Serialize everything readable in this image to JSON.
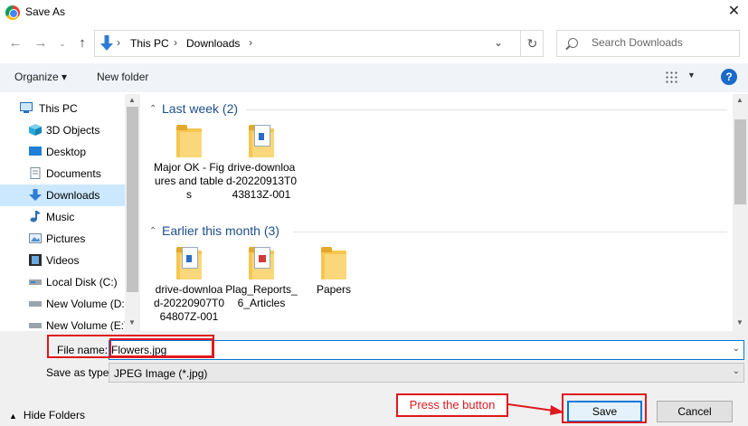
{
  "window": {
    "title": "Save As",
    "close_glyph": "✕",
    "icon": "chrome-icon"
  },
  "address": {
    "crumbs": [
      "This PC",
      "Downloads"
    ],
    "search_placeholder": "Search Downloads"
  },
  "toolbar": {
    "organize_label": "Organize ▾",
    "new_folder_label": "New folder",
    "help_label": "?"
  },
  "nav": {
    "items": [
      {
        "label": "This PC",
        "icon": "computer-icon"
      },
      {
        "label": "3D Objects",
        "icon": "cube-icon"
      },
      {
        "label": "Desktop",
        "icon": "desktop-icon"
      },
      {
        "label": "Documents",
        "icon": "documents-icon"
      },
      {
        "label": "Downloads",
        "icon": "download-arrow-icon",
        "selected": true
      },
      {
        "label": "Music",
        "icon": "music-note-icon"
      },
      {
        "label": "Pictures",
        "icon": "pictures-icon"
      },
      {
        "label": "Videos",
        "icon": "videos-icon"
      },
      {
        "label": "Local Disk (C:)",
        "icon": "drive-icon"
      },
      {
        "label": "New Volume (D:",
        "icon": "drive-icon"
      },
      {
        "label": "New Volume (E:)",
        "icon": "drive-icon"
      }
    ]
  },
  "groups": [
    {
      "title": "Last week (2)",
      "files": [
        {
          "name": "Major OK - Figures and tables",
          "kind": "folder"
        },
        {
          "name": "drive-download-20220913T043813Z-001",
          "kind": "folder-doc"
        }
      ]
    },
    {
      "title": "Earlier this month (3)",
      "files": [
        {
          "name": "drive-download-20220907T064807Z-001",
          "kind": "folder-doc"
        },
        {
          "name": "Plag_Reports_6_Articles",
          "kind": "folder-pdf"
        },
        {
          "name": "Papers",
          "kind": "folder"
        }
      ]
    }
  ],
  "form": {
    "file_name_label": "File name:",
    "file_name_value": "Flowers.jpg",
    "save_type_label": "Save as type:",
    "save_type_value": "JPEG Image (*.jpg)"
  },
  "footer": {
    "hide_folders_label": "Hide Folders",
    "save_label": "Save",
    "cancel_label": "Cancel"
  },
  "annotation": {
    "label": "Press the button",
    "color": "#e0181e"
  }
}
